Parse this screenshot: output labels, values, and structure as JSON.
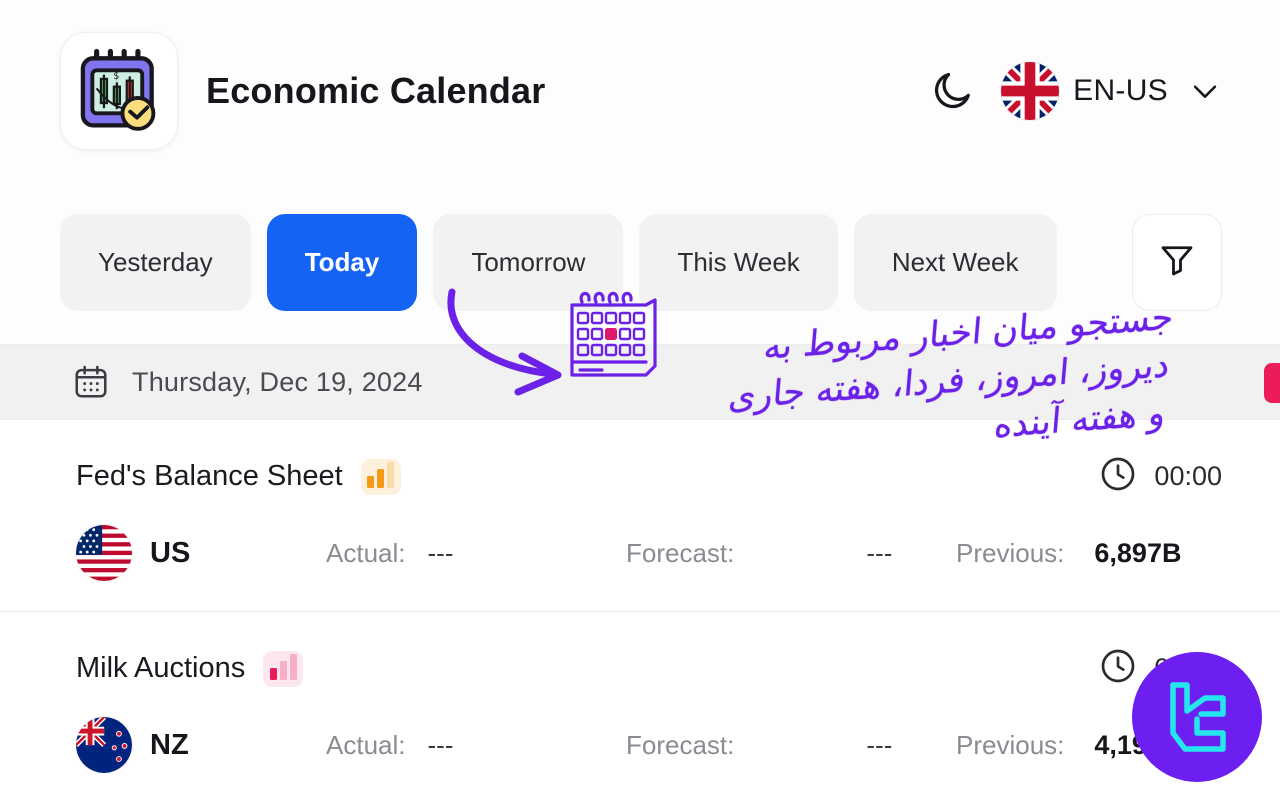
{
  "header": {
    "app_title": "Economic Calendar",
    "logo_icon": "calendar-candlestick-clock-icon",
    "theme_toggle_icon": "moon-icon",
    "flag_icon": "uk-flag-icon",
    "language": "EN-US",
    "chevron_icon": "chevron-down-icon"
  },
  "tabs": [
    {
      "label": "Yesterday",
      "active": false
    },
    {
      "label": "Today",
      "active": true
    },
    {
      "label": "Tomorrow",
      "active": false
    },
    {
      "label": "This Week",
      "active": false
    },
    {
      "label": "Next Week",
      "active": false
    }
  ],
  "filter": {
    "icon": "filter-funnel-icon"
  },
  "date_row": {
    "icon": "calendar-icon",
    "label": "Thursday, Dec 19, 2024"
  },
  "columns": {
    "actual": "Actual:",
    "forecast": "Forecast:",
    "previous": "Previous:"
  },
  "events": [
    {
      "title": "Fed's Balance Sheet",
      "impact": "medium",
      "impact_color": "#f59a16",
      "time": "00:00",
      "clock_icon": "clock-icon",
      "country_code": "US",
      "flag_icon": "us-flag-icon",
      "actual": "---",
      "forecast": "---",
      "previous": "6,897B"
    },
    {
      "title": "Milk Auctions",
      "impact": "low",
      "impact_color": "#ec1b5a",
      "time": "00:00",
      "clock_icon": "clock-icon",
      "country_code": "NZ",
      "flag_icon": "nz-flag-icon",
      "actual": "---",
      "forecast": "---",
      "previous": "4,193.0"
    }
  ],
  "annotation": {
    "line1": "جستجو میان اخبار مربوط به",
    "line2": "دیروز، امروز، فردا، هفته جاری",
    "line3": "و هفته آینده",
    "color": "#6b21e8",
    "arrow_icon": "curved-arrow-icon",
    "calendar_doodle_icon": "desk-calendar-doodle-icon"
  },
  "watermark": {
    "icon": "brand-logo-icon",
    "bg": "#6c1ff0",
    "fg": "#25e5ee"
  },
  "colors": {
    "accent_blue": "#1463f5",
    "impact_medium": "#f59a16",
    "impact_low": "#ec1b5a",
    "annotation_purple": "#6b21e8"
  }
}
